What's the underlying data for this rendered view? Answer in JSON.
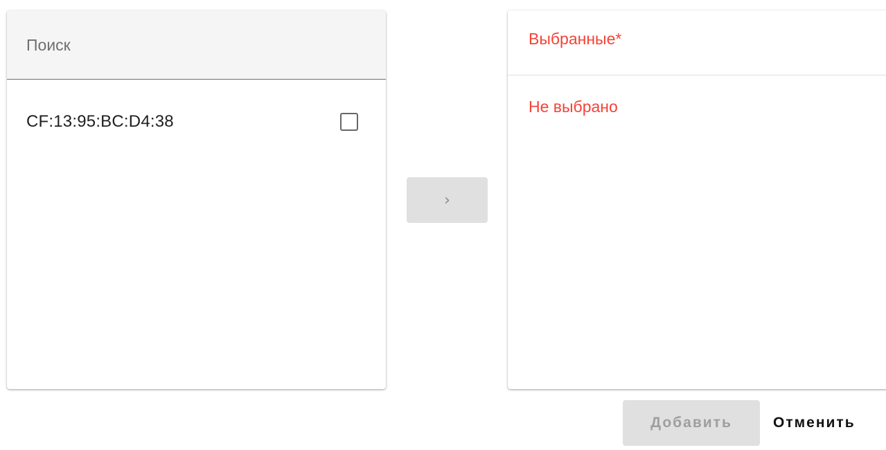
{
  "search": {
    "placeholder": "Поиск",
    "value": ""
  },
  "available": {
    "items": [
      {
        "label": "CF:13:95:BC:D4:38",
        "checked": false
      }
    ]
  },
  "move_button": {
    "icon": "chevron-right-icon",
    "glyph": "›"
  },
  "selected": {
    "title": "Выбранные*",
    "empty_text": "Не выбрано"
  },
  "actions": {
    "add_label": "Добавить",
    "cancel_label": "Отменить"
  },
  "colors": {
    "error_red": "#f44336",
    "disabled_gray": "#e0e0e0"
  }
}
